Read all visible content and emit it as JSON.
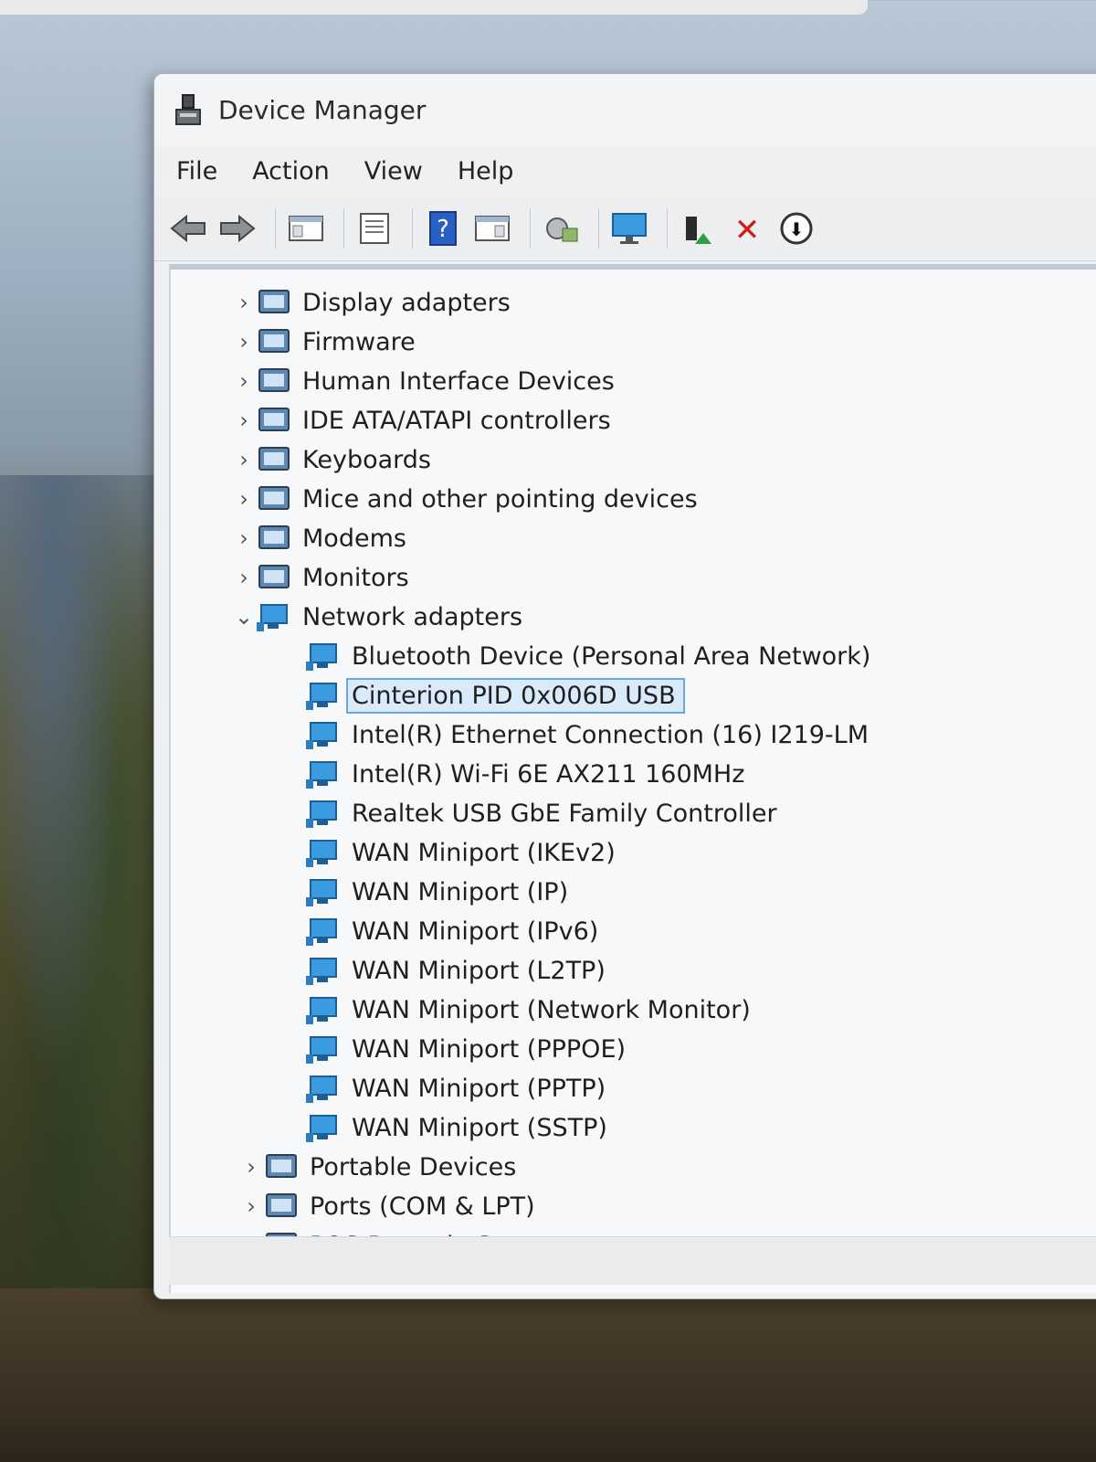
{
  "window": {
    "title": "Device Manager"
  },
  "menu": [
    "File",
    "Action",
    "View",
    "Help"
  ],
  "toolbar": [
    {
      "name": "back-arrow-icon"
    },
    {
      "name": "forward-arrow-icon"
    },
    {
      "name": "show-hide-console-tree-icon"
    },
    {
      "name": "properties-icon"
    },
    {
      "name": "help-icon",
      "glyph": "?"
    },
    {
      "name": "show-action-pane-icon"
    },
    {
      "name": "scan-hardware-changes-icon"
    },
    {
      "name": "display-device-icon"
    },
    {
      "name": "update-driver-icon"
    },
    {
      "name": "uninstall-device-icon",
      "glyph": "✕"
    },
    {
      "name": "disable-device-icon",
      "glyph": "⬇"
    }
  ],
  "tree": {
    "categories_top": [
      {
        "label": "Display adapters",
        "icon": "display-adapter-icon"
      },
      {
        "label": "Firmware",
        "icon": "firmware-icon"
      },
      {
        "label": "Human Interface Devices",
        "icon": "hid-icon"
      },
      {
        "label": "IDE ATA/ATAPI controllers",
        "icon": "ide-controller-icon"
      },
      {
        "label": "Keyboards",
        "icon": "keyboard-icon"
      },
      {
        "label": "Mice and other pointing devices",
        "icon": "mouse-icon"
      },
      {
        "label": "Modems",
        "icon": "modem-icon"
      },
      {
        "label": "Monitors",
        "icon": "monitor-icon"
      }
    ],
    "expanded": {
      "label": "Network adapters",
      "icon": "network-adapter-icon"
    },
    "network_adapters": [
      "Bluetooth Device (Personal Area Network)",
      "Cinterion PID 0x006D USB",
      "Intel(R) Ethernet Connection (16) I219-LM",
      "Intel(R) Wi-Fi 6E AX211 160MHz",
      "Realtek USB GbE Family Controller",
      "WAN Miniport (IKEv2)",
      "WAN Miniport (IP)",
      "WAN Miniport (IPv6)",
      "WAN Miniport (L2TP)",
      "WAN Miniport (Network Monitor)",
      "WAN Miniport (PPPOE)",
      "WAN Miniport (PPTP)",
      "WAN Miniport (SSTP)"
    ],
    "selected_adapter": "Cinterion PID 0x006D USB",
    "categories_bottom": [
      {
        "label": "Portable Devices",
        "icon": "portable-device-icon"
      },
      {
        "label": "Ports (COM & LPT)",
        "icon": "port-icon"
      },
      {
        "label": "POS Barcode Scanner",
        "icon": "barcode-scanner-icon"
      }
    ]
  },
  "colors": {
    "selection": "#d9ebfa",
    "selection_border": "#6aa7dc",
    "icon_blue": "#3a9be0"
  }
}
